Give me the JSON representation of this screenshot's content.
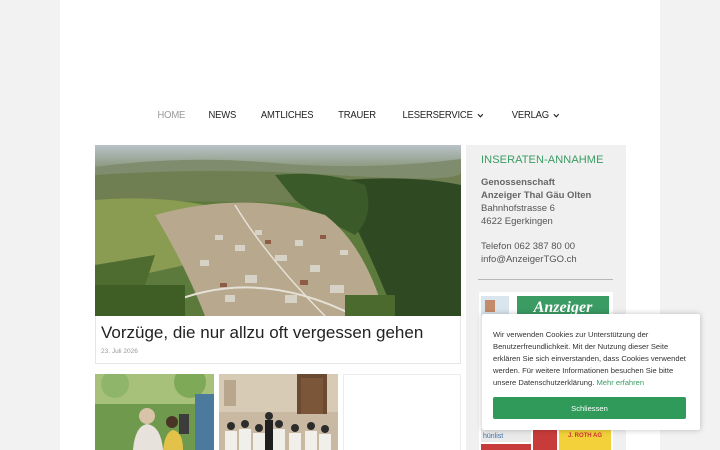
{
  "nav": {
    "items": [
      {
        "label": "HOME",
        "active": true,
        "dropdown": false
      },
      {
        "label": "NEWS",
        "active": false,
        "dropdown": false
      },
      {
        "label": "AMTLICHES",
        "active": false,
        "dropdown": false
      },
      {
        "label": "TRAUER",
        "active": false,
        "dropdown": false
      },
      {
        "label": "LESERSERVICE",
        "active": false,
        "dropdown": true
      },
      {
        "label": "VERLAG",
        "active": false,
        "dropdown": true
      }
    ]
  },
  "hero": {
    "title": "Vorzüge, die nur allzu oft vergessen gehen",
    "date": "23. Juli 2026"
  },
  "sidebar": {
    "heading": "INSERATEN-ANNAHME",
    "company_line1": "Genossenschaft",
    "company_line2": "Anzeiger Thal Gäu Olten",
    "street": "Bahnhofstrasse 6",
    "city": "4622 Egerkingen",
    "phone": "Telefon 062 387 80 00",
    "email": "info@AnzeigerTGO.ch"
  },
  "ad": {
    "logo_text": "Anzeiger",
    "small_text": "hünlist",
    "ad_text": "J. ROTH AG"
  },
  "cookie": {
    "text": "Wir verwenden Cookies zur Unterstützung der Benutzerfreundlichkeit. Mit der Nutzung dieser Seite erklären Sie sich einverstanden, dass Cookies verwendet werden. Für weitere Informationen besuchen Sie bitte unsere Datenschutzerklärung.",
    "link": "Mehr erfahren",
    "button": "Schliessen"
  },
  "colors": {
    "accent": "#3a9b63",
    "button": "#2f9a5a"
  }
}
